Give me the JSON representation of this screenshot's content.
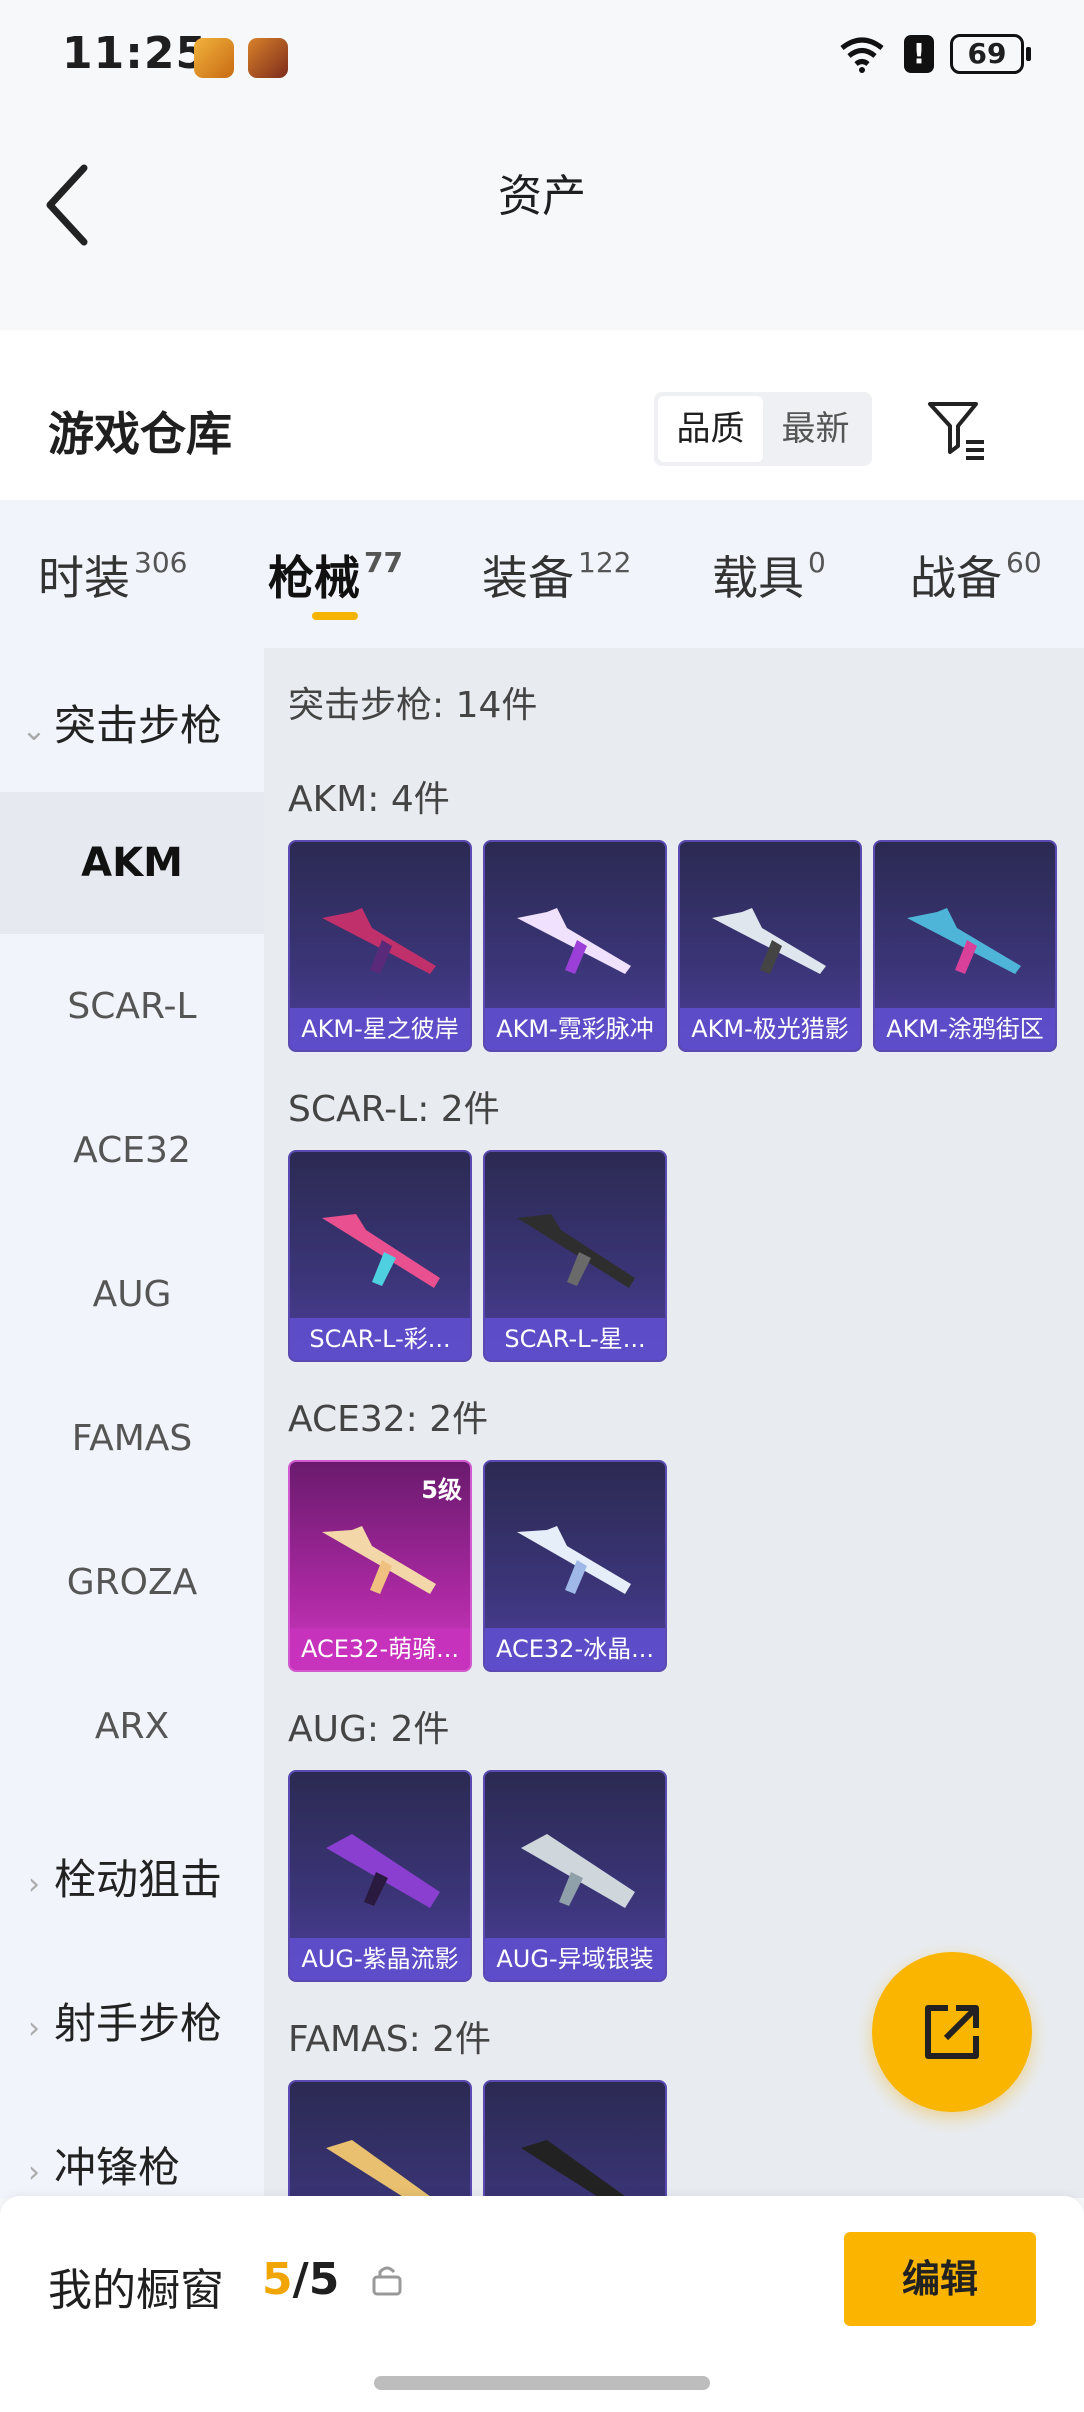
{
  "status": {
    "time": "11:25",
    "battery": "69",
    "alert": "!"
  },
  "header": {
    "title": "资产"
  },
  "warehouse": {
    "title": "游戏仓库",
    "sort": [
      "品质",
      "最新"
    ]
  },
  "tabs": [
    {
      "label": "时装",
      "count": "306"
    },
    {
      "label": "枪械",
      "count": "77"
    },
    {
      "label": "装备",
      "count": "122"
    },
    {
      "label": "载具",
      "count": "0"
    },
    {
      "label": "战备",
      "count": "60"
    }
  ],
  "sidebar": {
    "expanded": "突击步枪",
    "subs": [
      "AKM",
      "SCAR-L",
      "ACE32",
      "AUG",
      "FAMAS",
      "GROZA",
      "ARX"
    ],
    "collapsed": [
      "栓动狙击",
      "射手步枪",
      "冲锋枪"
    ]
  },
  "main": {
    "summary": "突击步枪: 14件",
    "groups": [
      {
        "title": "AKM: 4件",
        "items": [
          "AKM-星之彼岸",
          "AKM-霓彩脉冲",
          "AKM-极光猎影",
          "AKM-涂鸦街区"
        ]
      },
      {
        "title": "SCAR-L: 2件",
        "items": [
          "SCAR-L-彩...",
          "SCAR-L-星..."
        ]
      },
      {
        "title": "ACE32: 2件",
        "items": [
          "ACE32-萌骑...",
          "ACE32-冰晶..."
        ],
        "level": "5级"
      },
      {
        "title": "AUG: 2件",
        "items": [
          "AUG-紫晶流影",
          "AUG-异域银装"
        ]
      },
      {
        "title": "FAMAS: 2件",
        "items": [
          "",
          ""
        ]
      }
    ]
  },
  "bottom": {
    "label": "我的橱窗",
    "current": "5",
    "total": "/5",
    "edit": "编辑"
  },
  "colors": {
    "accent": "#f9b500",
    "card": "#3b3578"
  }
}
